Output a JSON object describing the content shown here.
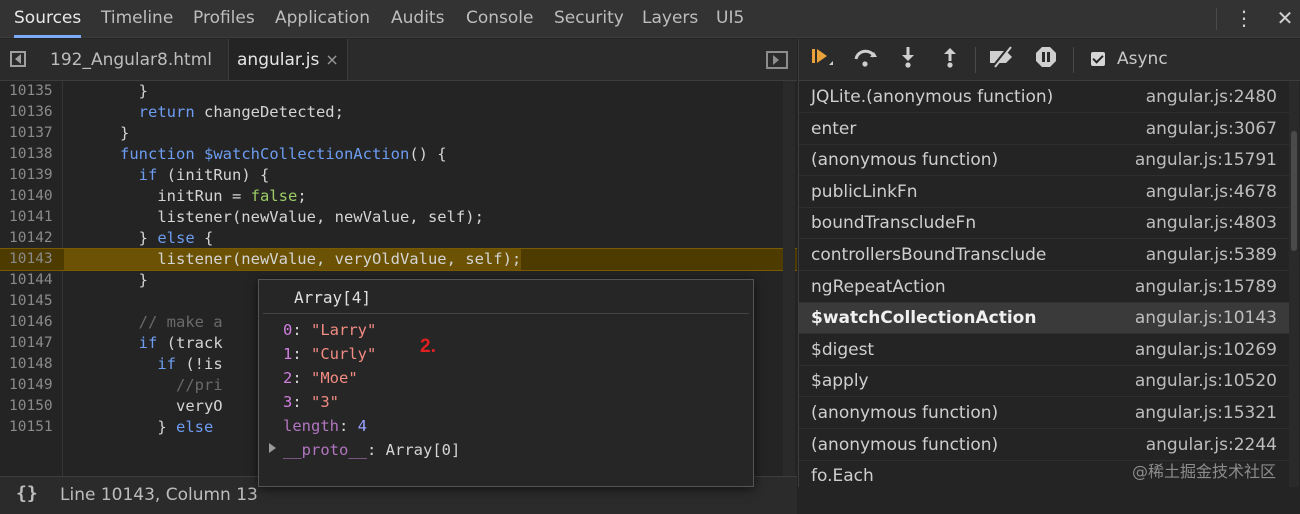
{
  "top_tabs": [
    {
      "label": "Sources",
      "active": true
    },
    {
      "label": "Timeline",
      "active": false
    },
    {
      "label": "Profiles",
      "active": false
    },
    {
      "label": "Application",
      "active": false
    },
    {
      "label": "Audits",
      "active": false
    },
    {
      "label": "Console",
      "active": false
    },
    {
      "label": "Security",
      "active": false
    },
    {
      "label": "Layers",
      "active": false
    },
    {
      "label": "UI5",
      "active": false
    }
  ],
  "top_icons": {
    "more": "more-vertical-icon",
    "close": "close-icon"
  },
  "file_tabs": [
    {
      "label": "192_Angular8.html",
      "active": false
    },
    {
      "label": "angular.js",
      "active": true,
      "close_glyph": "×"
    }
  ],
  "code_lines": [
    {
      "ln": "10135",
      "text": "        }"
    },
    {
      "ln": "10136",
      "text": "        return changeDetected;"
    },
    {
      "ln": "10137",
      "text": "      }"
    },
    {
      "ln": "10138",
      "text": "      function $watchCollectionAction() {"
    },
    {
      "ln": "10139",
      "text": "        if (initRun) {"
    },
    {
      "ln": "10140",
      "text": "          initRun = false;"
    },
    {
      "ln": "10141",
      "text": "          listener(newValue, newValue, self);"
    },
    {
      "ln": "10142",
      "text": "        } else {"
    },
    {
      "ln": "10143",
      "text": "          listener(newValue, veryOldValue, self);",
      "highlighted": true
    },
    {
      "ln": "10144",
      "text": "        }"
    },
    {
      "ln": "10145",
      "text": ""
    },
    {
      "ln": "10146",
      "text": "        // make a"
    },
    {
      "ln": "10147",
      "text": "        if (track"
    },
    {
      "ln": "10148",
      "text": "          if (!is"
    },
    {
      "ln": "10149",
      "text": "            //pri"
    },
    {
      "ln": "10150",
      "text": "            veryO"
    },
    {
      "ln": "10151",
      "text": "          } else"
    }
  ],
  "status_bar": {
    "braces": "{}",
    "position": "Line 10143, Column 13"
  },
  "popover": {
    "title": "Array[4]",
    "items": [
      {
        "key": "0",
        "value": "\"Larry\"",
        "kind": "string"
      },
      {
        "key": "1",
        "value": "\"Curly\"",
        "kind": "string"
      },
      {
        "key": "2",
        "value": "\"Moe\"",
        "kind": "string"
      },
      {
        "key": "3",
        "value": "\"3\"",
        "kind": "string"
      },
      {
        "key": "length",
        "value": "4",
        "kind": "number"
      },
      {
        "key": "__proto__",
        "value": "Array[0]",
        "kind": "plain"
      }
    ]
  },
  "annotation": "2.",
  "debugger_toolbar": {
    "buttons": [
      "resume-icon",
      "step-over-icon",
      "step-into-icon",
      "step-out-icon",
      "deactivate-breakpoints-icon",
      "pause-on-exceptions-icon"
    ],
    "async_label": "Async",
    "async_checked": true
  },
  "call_stack": [
    {
      "fn": "JQLite.(anonymous function)",
      "loc": "angular.js:2480"
    },
    {
      "fn": "enter",
      "loc": "angular.js:3067"
    },
    {
      "fn": "(anonymous function)",
      "loc": "angular.js:15791"
    },
    {
      "fn": "publicLinkFn",
      "loc": "angular.js:4678"
    },
    {
      "fn": "boundTranscludeFn",
      "loc": "angular.js:4803"
    },
    {
      "fn": "controllersBoundTransclude",
      "loc": "angular.js:5389"
    },
    {
      "fn": "ngRepeatAction",
      "loc": "angular.js:15789"
    },
    {
      "fn": "$watchCollectionAction",
      "loc": "angular.js:10143",
      "selected": true
    },
    {
      "fn": "$digest",
      "loc": "angular.js:10269"
    },
    {
      "fn": "$apply",
      "loc": "angular.js:10520"
    },
    {
      "fn": "(anonymous function)",
      "loc": "angular.js:15321"
    },
    {
      "fn": "(anonymous function)",
      "loc": "angular.js:2244"
    },
    {
      "fn": "fo.Each",
      "loc": ""
    }
  ],
  "watermark": "@稀土掘金技术社区"
}
